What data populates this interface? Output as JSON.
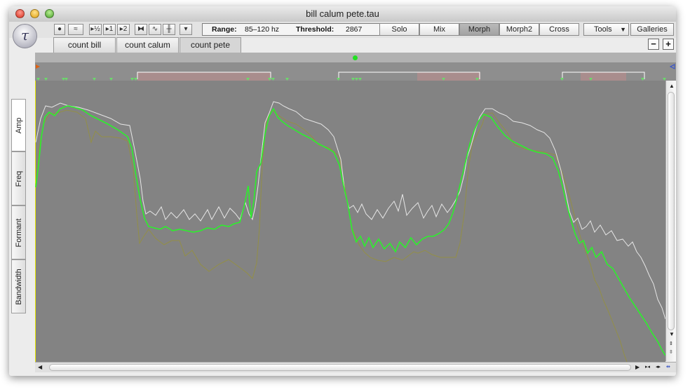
{
  "window": {
    "title": "bill calum pete.tau"
  },
  "toolbar": {
    "logo_glyph": "τ",
    "icon_buttons": [
      {
        "name": "record-dot-icon",
        "glyph": "●"
      },
      {
        "name": "waveform-icon",
        "glyph": "≈"
      },
      {
        "name": "play-half-icon",
        "glyph": "▸½"
      },
      {
        "name": "play-1-icon",
        "glyph": "▸1"
      },
      {
        "name": "play-2-icon",
        "glyph": "▸2"
      },
      {
        "name": "bowtie-icon",
        "glyph": "⧓"
      },
      {
        "name": "sine-wave-icon",
        "glyph": "∿"
      },
      {
        "name": "spectrum-icon",
        "glyph": "╫"
      },
      {
        "name": "color-dropdown-icon",
        "glyph": "▾"
      }
    ],
    "range_label": "Range:",
    "range_value": "85–120 hz",
    "threshold_label": "Threshold:",
    "threshold_value": "2867",
    "modes": [
      "Solo",
      "Mix",
      "Morph",
      "Morph2",
      "Cross"
    ],
    "selected_mode": "Morph",
    "tools_label": "Tools",
    "galleries_label": "Galleries"
  },
  "tabs": [
    {
      "label": "count bill",
      "active": false
    },
    {
      "label": "count calum",
      "active": false
    },
    {
      "label": "count pete",
      "active": true
    }
  ],
  "zoom": {
    "minus": "−",
    "plus": "+"
  },
  "side_tabs": [
    {
      "label": "Amp",
      "active": true
    },
    {
      "label": "Freq",
      "active": false
    },
    {
      "label": "Formant",
      "active": false
    },
    {
      "label": "Bandwidth",
      "active": false
    }
  ],
  "colors": {
    "plot_bg": "#838383",
    "marker_strip": "#8e8e8e",
    "segment_highlight": "#a98d8d",
    "curve_green": "#2cf02c",
    "curve_white": "#e6e6e6",
    "curve_olive": "#938f46",
    "marker_green": "#6bdb6b"
  }
}
